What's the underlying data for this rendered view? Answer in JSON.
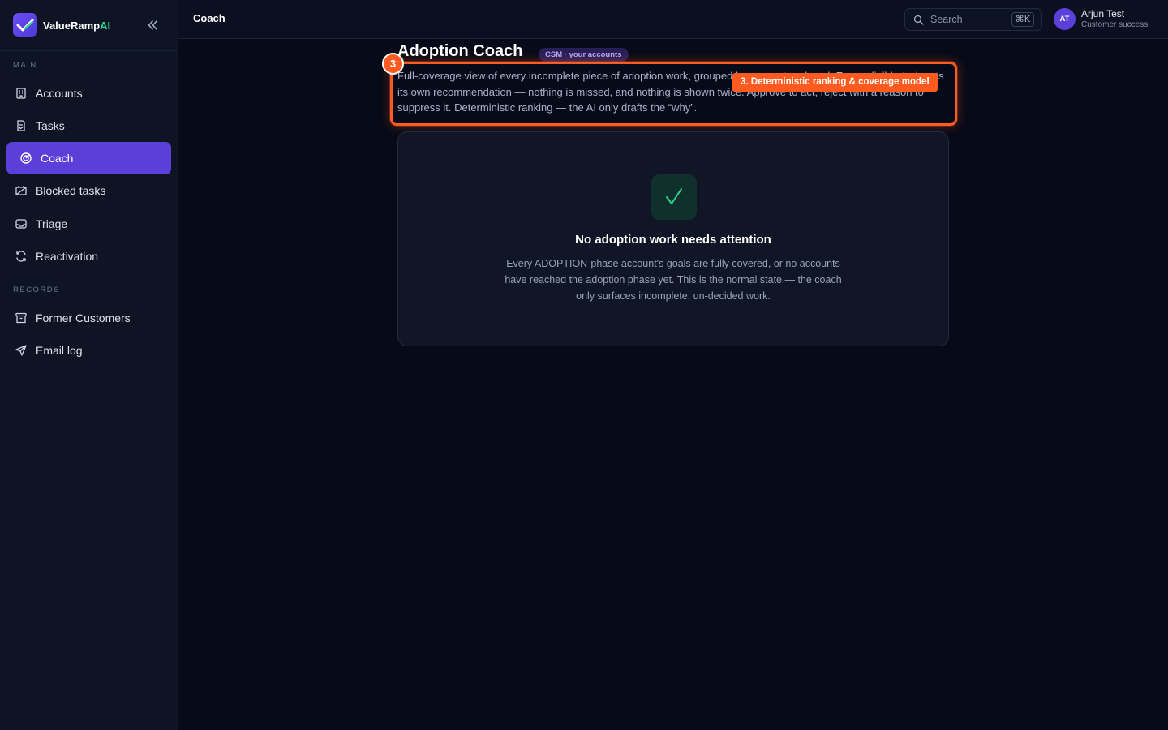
{
  "brand": {
    "name_main": "ValueRamp",
    "name_accent": "AI"
  },
  "sidebar": {
    "sections": [
      {
        "label": "MAIN"
      },
      {
        "label": "RECORDS"
      }
    ],
    "items": [
      {
        "label": "Accounts",
        "icon": "building-icon"
      },
      {
        "label": "Tasks",
        "icon": "task-icon"
      },
      {
        "label": "Coach",
        "icon": "target-icon",
        "active": true
      },
      {
        "label": "Blocked tasks",
        "icon": "blocked-icon"
      },
      {
        "label": "Triage",
        "icon": "inbox-icon"
      },
      {
        "label": "Reactivation",
        "icon": "refresh-icon"
      },
      {
        "label": "Former Customers",
        "icon": "archive-icon"
      },
      {
        "label": "Email log",
        "icon": "send-icon"
      }
    ]
  },
  "topbar": {
    "breadcrumb": "Coach",
    "search": {
      "placeholder": "Search",
      "shortcut": "⌘K"
    },
    "user": {
      "initials": "AT",
      "name": "Arjun Test",
      "role": "Customer success"
    }
  },
  "page": {
    "title": "Adoption Coach",
    "badge": "CSM · your accounts",
    "description": "Full-coverage view of every incomplete piece of adoption work, grouped by account and goal. Every eligible task gets its own recommendation — nothing is missed, and nothing is shown twice. Approve to act, reject with a reason to suppress it. Deterministic ranking — the AI only drafts the “why”."
  },
  "annotation": {
    "number": "3",
    "label": "3. Deterministic ranking & coverage model"
  },
  "empty_state": {
    "icon": "check-icon",
    "title": "No adoption work needs attention",
    "body": "Every ADOPTION-phase account's goals are fully covered, or no accounts have reached the adoption phase yet. This is the normal state — the coach only surfaces incomplete, un-decided work."
  },
  "colors": {
    "accent": "#5b3fd9",
    "highlight": "#ff5a1f",
    "success": "#2fd38a",
    "background": "#070a18"
  }
}
